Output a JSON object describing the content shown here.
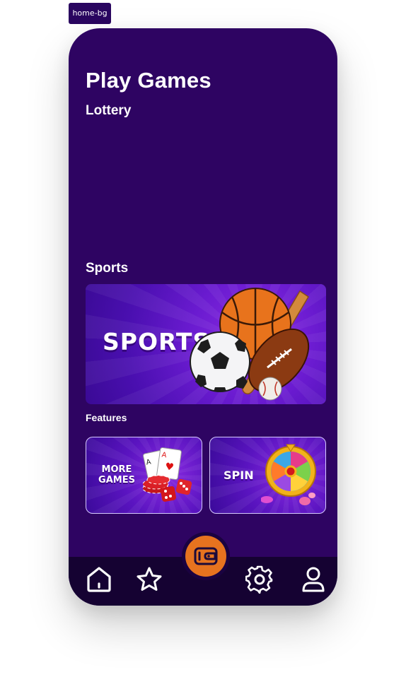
{
  "frame_label": "home-bg",
  "header": {
    "title": "Play Games"
  },
  "sections": {
    "lottery": "Lottery",
    "sports": "Sports",
    "features": "Features"
  },
  "sports_banner": {
    "label": "SPORTS"
  },
  "features": [
    {
      "line1": "MORE",
      "line2": "GAMES"
    },
    {
      "label": "SPIN"
    }
  ],
  "colors": {
    "background": "#2e0462",
    "navbar": "#150232",
    "accent": "#e6731f",
    "card_border": "#d6c8ff"
  },
  "nav": {
    "items": [
      "home-icon",
      "star-icon",
      "wallet-icon",
      "gear-icon",
      "user-icon"
    ]
  }
}
